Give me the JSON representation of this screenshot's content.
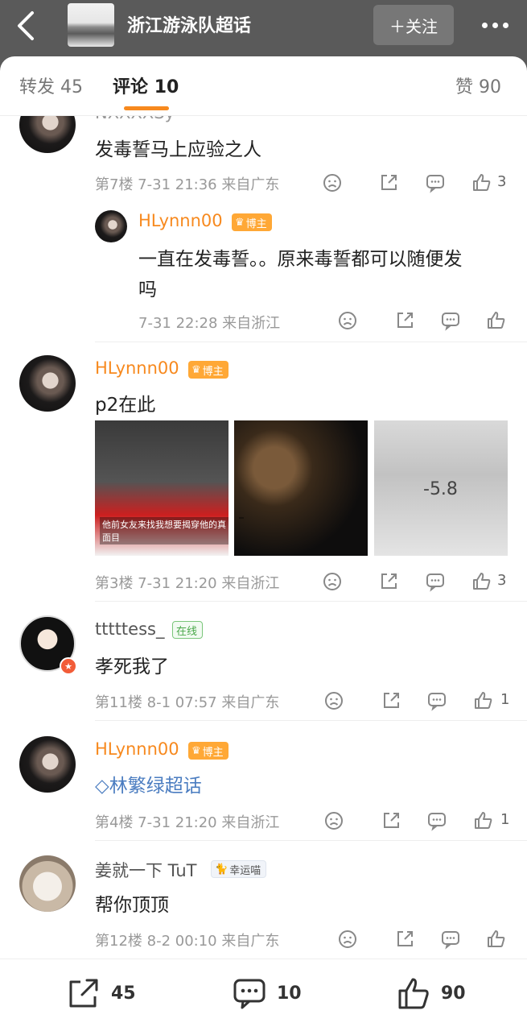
{
  "header": {
    "title": "浙江游泳队超话",
    "follow_label": "＋关注",
    "more_icon": "more-dots-icon"
  },
  "tabs": [
    {
      "label": "转发",
      "count": "45"
    },
    {
      "label": "评论",
      "count": "10"
    },
    {
      "label": "赞",
      "count": "90"
    }
  ],
  "comments": [
    {
      "user": "NXXXXSy",
      "text": "发毒誓马上应验之人",
      "meta": "第7楼 7-31 21:36 来自广东",
      "likes": "3",
      "reply": {
        "user": "HLynnn00",
        "badge": "博主",
        "text_line1": "一直在发毒誓。。原来毒誓都可以随便发",
        "text_line2": "吗",
        "meta": "7-31 22:28 来自浙江"
      }
    },
    {
      "user": "HLynnn00",
      "badge": "博主",
      "text": "p2在此",
      "images": [
        {
          "caption": "他前女友来找我想要揭穿他的真面目"
        },
        {
          "caption": ""
        },
        {
          "caption": "-5.8"
        }
      ],
      "meta": "第3楼 7-31 21:20 来自浙江",
      "likes": "3"
    },
    {
      "user": "tttttess_",
      "badge": "在线",
      "text": "孝死我了",
      "meta": "第11楼 8-1 07:57 来自广东",
      "likes": "1"
    },
    {
      "user": "HLynnn00",
      "badge": "博主",
      "text": "林繁绿超话",
      "meta": "第4楼 7-31 21:20 来自浙江",
      "likes": "1"
    },
    {
      "user": "姜就一下 TuT",
      "badge": "幸运喵",
      "text": "帮你顶顶",
      "meta": "第12楼 8-2 00:10 来自广东",
      "likes": ""
    }
  ],
  "bottom": {
    "repost_count": "45",
    "comment_count": "10",
    "like_count": "90"
  },
  "colors": {
    "accent_orange": "#f7891e",
    "blogger_badge": "#ffa836"
  }
}
